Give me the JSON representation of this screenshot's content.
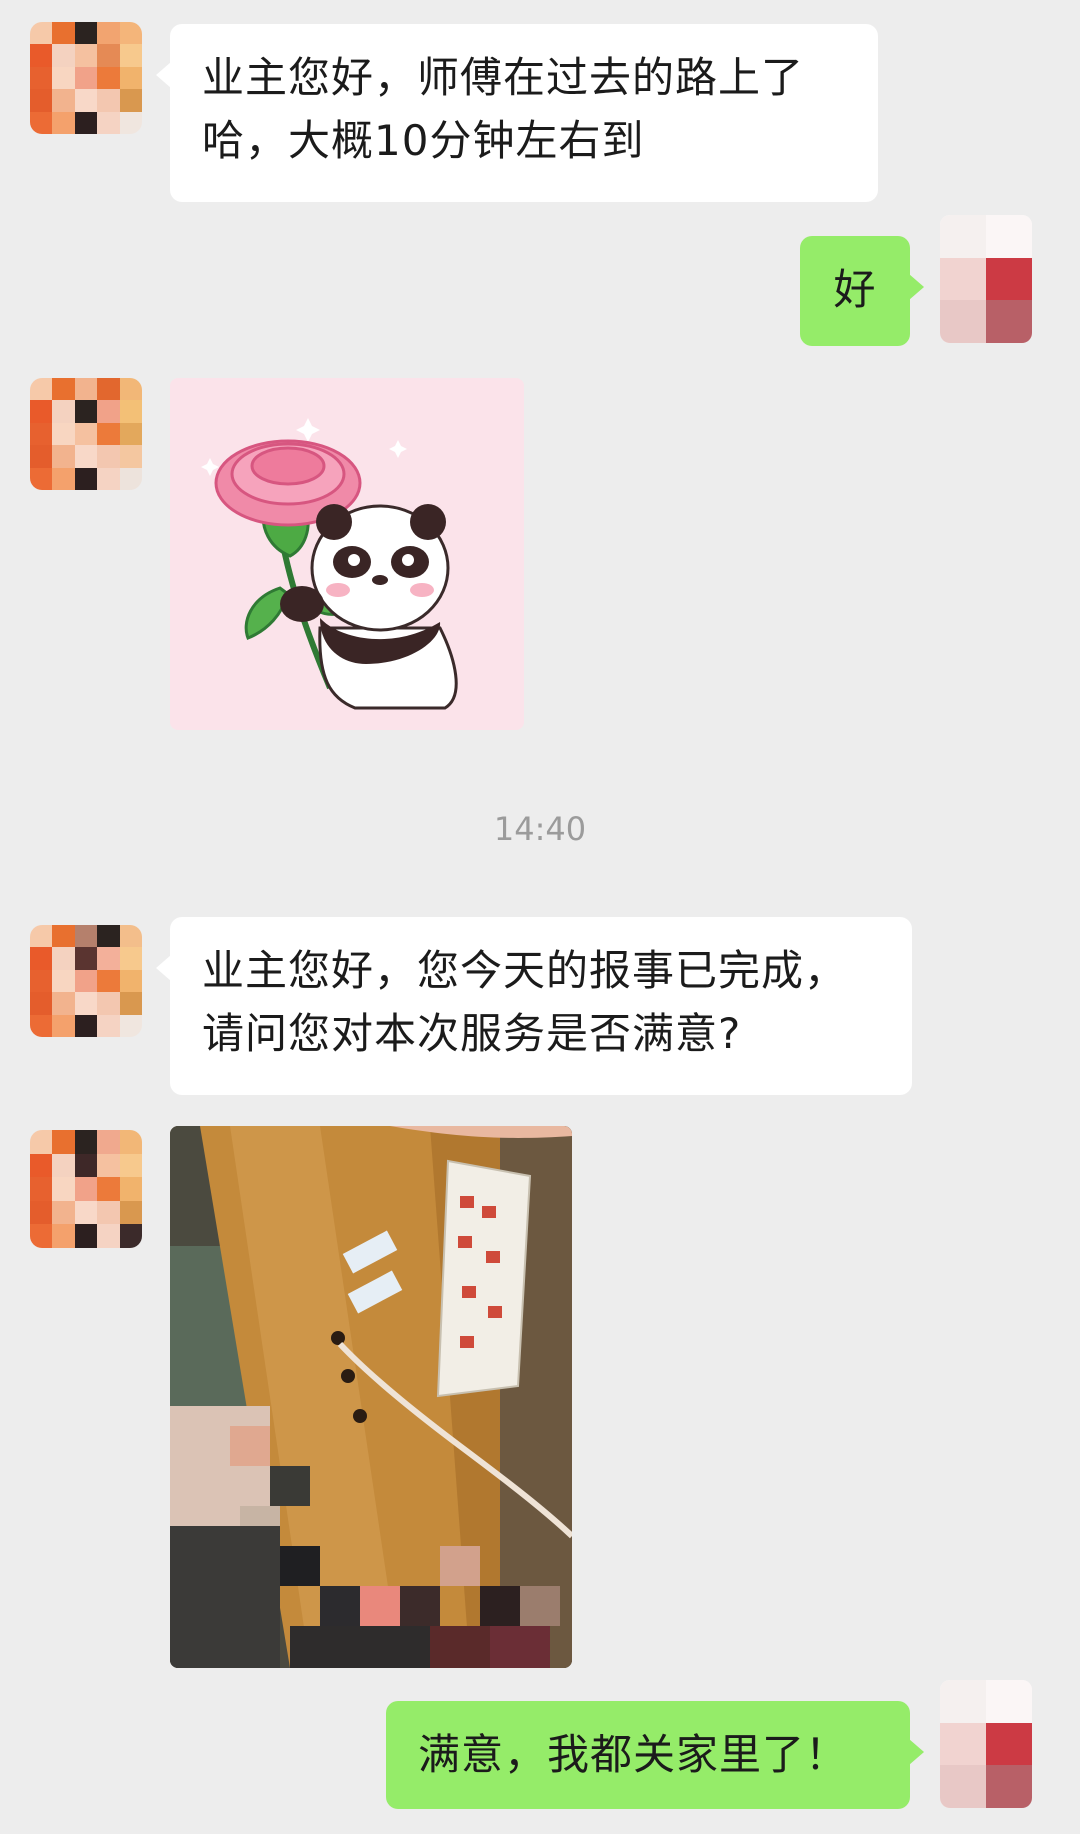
{
  "colors": {
    "background": "#ededed",
    "bubble_incoming": "#ffffff",
    "bubble_outgoing": "#95ec69",
    "timestamp_text": "#9b9b9b"
  },
  "messages": [
    {
      "sender": "agent",
      "type": "text",
      "text_line1": "业主您好，师傅在过去的路上了",
      "text_line2": "哈，大概10分钟左右到"
    },
    {
      "sender": "user",
      "type": "text",
      "text": "好"
    },
    {
      "sender": "agent",
      "type": "sticker",
      "sticker_icon": "panda-holding-carnation"
    },
    {
      "type": "timestamp",
      "text": "14:40"
    },
    {
      "sender": "agent",
      "type": "text",
      "text_line1": "业主您好，您今天的报事已完成，",
      "text_line2": "请问您对本次服务是否满意?"
    },
    {
      "sender": "agent",
      "type": "image",
      "image_icon": "elevator-panel-photo"
    },
    {
      "sender": "user",
      "type": "text",
      "text": "满意，我都关家里了！"
    }
  ]
}
